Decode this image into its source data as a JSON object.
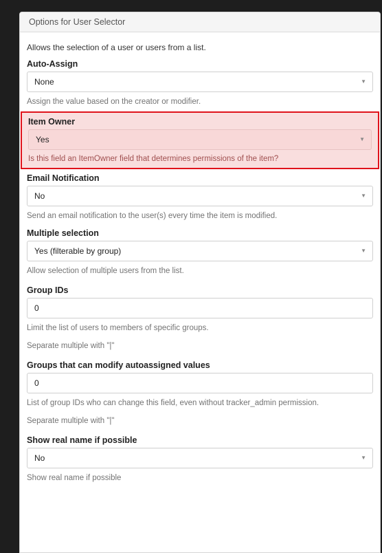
{
  "panel": {
    "title": "Options for User Selector",
    "description": "Allows the selection of a user or users from a list."
  },
  "fields": [
    {
      "label": "Auto-Assign",
      "value": "None",
      "help": "Assign the value based on the creator or modifier."
    },
    {
      "label": "Item Owner",
      "value": "Yes",
      "help": "Is this field an ItemOwner field that determines permissions of the item?"
    },
    {
      "label": "Email Notification",
      "value": "No",
      "help": "Send an email notification to the user(s) every time the item is modified."
    },
    {
      "label": "Multiple selection",
      "value": "Yes (filterable by group)",
      "help": "Allow selection of multiple users from the list."
    },
    {
      "label": "Group IDs",
      "value": "0",
      "help": "Limit the list of users to members of specific groups.",
      "help2": "Separate multiple with \"|\""
    },
    {
      "label": "Groups that can modify autoassigned values",
      "value": "0",
      "help": "List of group IDs who can change this field, even without tracker_admin permission.",
      "help2": "Separate multiple with \"|\""
    },
    {
      "label": "Show real name if possible",
      "value": "No",
      "help": "Show real name if possible"
    }
  ],
  "colors": {
    "highlight_border": "#e0121b",
    "highlight_bg": "#f9dede"
  },
  "icons": {
    "select_caret": "▼"
  }
}
